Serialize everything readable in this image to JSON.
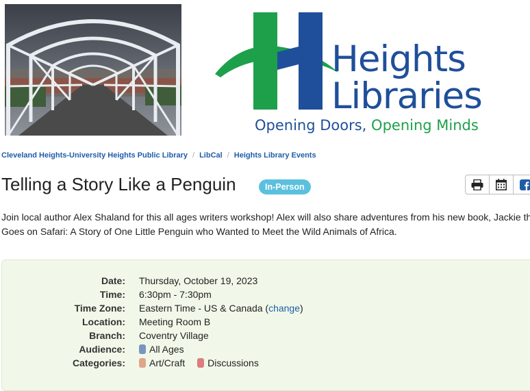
{
  "logo": {
    "word1": "Heights",
    "word2": "Libraries",
    "tagline_part1": "Opening Doors,",
    "tagline_part2": "Opening Minds",
    "brand_blue": "#1f4f9a",
    "brand_green": "#1ea04b"
  },
  "breadcrumb": [
    {
      "label": "Cleveland Heights-University Heights Public Library"
    },
    {
      "label": "LibCal"
    },
    {
      "label": "Heights Library Events"
    }
  ],
  "event": {
    "title": "Telling a Story Like a Penguin",
    "badge": "In-Person",
    "badge_color": "#5bc0de",
    "description_line1": "Join local author Alex Shaland for this all ages writers workshop! Alex will also share adventures from his new book, Jackie the",
    "description_line2": "Goes on Safari: A Story of One Little Penguin who Wanted to Meet the Wild Animals of Africa."
  },
  "actions": [
    "print-icon",
    "calendar-icon",
    "facebook-icon"
  ],
  "details": {
    "date_label": "Date:",
    "date": "Thursday, October 19, 2023",
    "time_label": "Time:",
    "time": "6:30pm - 7:30pm",
    "tz_label": "Time Zone:",
    "tz": "Eastern Time - US & Canada (",
    "tz_link": "change",
    "tz_close": ")",
    "location_label": "Location:",
    "location": "Meeting Room B",
    "branch_label": "Branch:",
    "branch": "Coventry Village",
    "audience_label": "Audience:",
    "audience": "All Ages",
    "audience_color": "#7a95bf",
    "categories_label": "Categories:",
    "cat1": "Art/Craft",
    "cat1_color": "#e0a489",
    "cat2": "Discussions",
    "cat2_color": "#dd7d7d"
  }
}
